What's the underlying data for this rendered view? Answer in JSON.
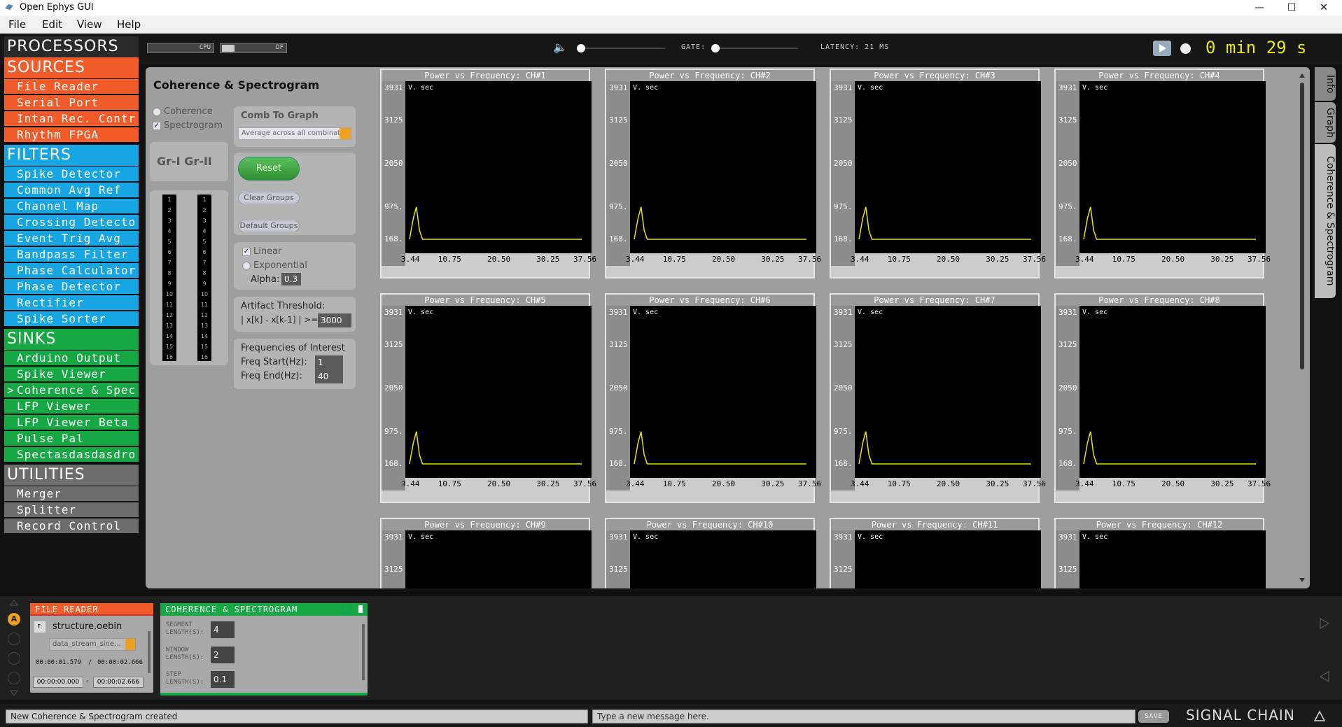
{
  "window": {
    "title": "Open Ephys GUI",
    "min": "—",
    "max": "☐",
    "close": "✕"
  },
  "menu": [
    "File",
    "Edit",
    "View",
    "Help"
  ],
  "topbar": {
    "cpu_label": "CPU",
    "df_label": "DF",
    "gate_label": "GATE:",
    "latency": "LATENCY: 21 MS",
    "clock": "0 min 29 s"
  },
  "processors": {
    "title": "PROCESSORS",
    "sections": [
      {
        "name": "SOURCES",
        "kind": "src",
        "items": [
          "File Reader",
          "Serial Port",
          "Intan Rec. Contr",
          "Rhythm FPGA"
        ]
      },
      {
        "name": "FILTERS",
        "kind": "flt",
        "items": [
          "Spike Detector",
          "Common Avg Ref",
          "Channel Map",
          "Crossing Detecto",
          "Event Trig Avg",
          "Bandpass Filter",
          "Phase Calculator",
          "Phase Detector",
          "Rectifier",
          "Spike Sorter"
        ]
      },
      {
        "name": "SINKS",
        "kind": "snk",
        "items": [
          "Arduino Output",
          "Spike Viewer",
          "Coherence & Spec",
          "LFP Viewer",
          "LFP Viewer Beta",
          "Pulse Pal",
          "Spectasdasdasdro"
        ]
      },
      {
        "name": "UTILITIES",
        "kind": "utl",
        "items": [
          "Merger",
          "Splitter",
          "Record Control"
        ]
      }
    ],
    "selected_marker": ">"
  },
  "canvas": {
    "title": "Coherence & Spectrogram",
    "mode_coherence": "Coherence",
    "mode_spectrogram": "Spectrogram",
    "comb_label": "Comb To Graph",
    "comb_value": "Average across all combinat...",
    "groups_label": "Gr-I Gr-II",
    "reset": "Reset",
    "clear_groups": "Clear Groups",
    "default_groups": "Default Groups",
    "linear": "Linear",
    "exponential": "Exponential",
    "alpha_label": "Alpha:",
    "alpha_value": "0.3",
    "artifact_label": "Artifact Threshold:",
    "artifact_expr": "| x[k] - x[k-1] | >=",
    "artifact_value": "3000",
    "freq_title": "Frequencies of Interest",
    "freq_start_label": "Freq Start(Hz):",
    "freq_start": "1",
    "freq_end_label": "Freq End(Hz):",
    "freq_end": "40",
    "group_channels": [
      "1",
      "2",
      "3",
      "4",
      "5",
      "6",
      "7",
      "8",
      "9",
      "10",
      "11",
      "12",
      "13",
      "14",
      "15",
      "16"
    ]
  },
  "graphs": {
    "title_prefix": "Power vs Frequency: CH#",
    "channels": [
      "1",
      "2",
      "3",
      "4",
      "5",
      "6",
      "7",
      "8",
      "9",
      "10",
      "11",
      "12"
    ],
    "units": "V. sec",
    "yticks": [
      "3931",
      "3125",
      "2050",
      "975.",
      "168."
    ],
    "xticks": [
      "3.44",
      "10.75",
      "20.50",
      "30.25",
      "37.56"
    ]
  },
  "chart_data": {
    "type": "line",
    "title": "Power vs Frequency",
    "x": [
      3.44,
      4.2,
      4.8,
      5.4,
      6.0,
      10.75,
      20.5,
      30.25,
      37.56
    ],
    "series": [
      {
        "values": [
          168,
          700,
          975,
          400,
          168,
          168,
          168,
          168,
          168
        ]
      }
    ],
    "ylim": [
      168,
      3931
    ],
    "xlim": [
      3.44,
      37.56
    ],
    "line_color": "#e6e600"
  },
  "sidetabs": [
    "Info",
    "Graph",
    "Coherence & Spectrogram"
  ],
  "chain": {
    "file_reader": {
      "title": "FILE READER",
      "file": "structure.oebin",
      "stream": "data_stream_sine...",
      "time_cur": "00:00:01.579",
      "time_sep": "/",
      "time_total": "00:00:02.666",
      "start": "00:00:00.000",
      "dash": "-",
      "end": "00:00:02.666",
      "f_btn": "F:"
    },
    "coherence": {
      "title": "COHERENCE & SPECTROGRAM",
      "seg_label": "SEGMENT LENGTH(S):",
      "seg": "4",
      "win_label": "WINDOW LENGTH(S):",
      "win": "2",
      "step_label": "STEP LENGTH(S):",
      "step": "0.1"
    },
    "badge": "A",
    "title": "SIGNAL CHAIN"
  },
  "status": {
    "message": "New Coherence & Spectrogram created",
    "placeholder": "Type a new message here.",
    "save": "SAVE"
  }
}
